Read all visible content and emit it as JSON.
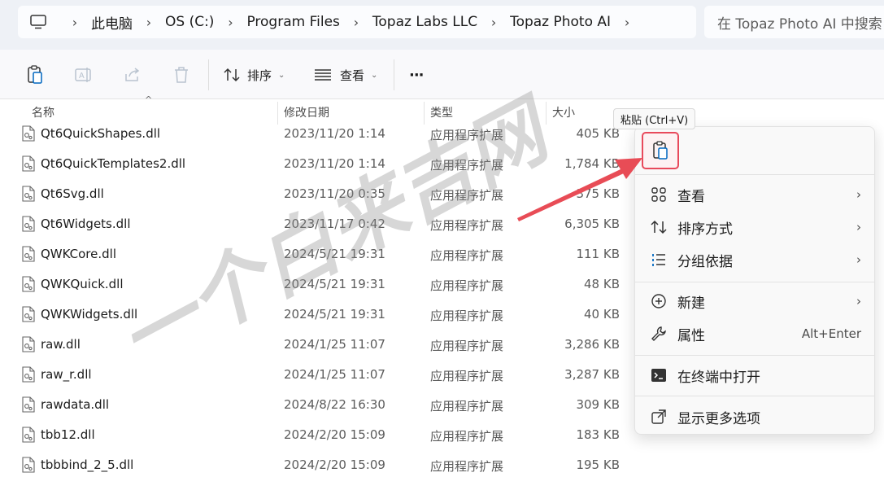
{
  "breadcrumb": [
    "此电脑",
    "OS (C:)",
    "Program Files",
    "Topaz Labs LLC",
    "Topaz Photo AI"
  ],
  "search": {
    "placeholder": "在 Topaz Photo AI 中搜索"
  },
  "toolbar": {
    "icons": [
      "paste-icon",
      "rename-icon",
      "share-icon",
      "delete-icon"
    ],
    "sort_label": "排序",
    "view_label": "查看",
    "more_label": "···"
  },
  "columns": {
    "name": "名称",
    "date": "修改日期",
    "type": "类型",
    "size": "大小"
  },
  "files": [
    {
      "name": "Qt6QuickShapes.dll",
      "date": "2023/11/20 1:14",
      "type": "应用程序扩展",
      "size": "405 KB"
    },
    {
      "name": "Qt6QuickTemplates2.dll",
      "date": "2023/11/20 1:14",
      "type": "应用程序扩展",
      "size": "1,784 KB"
    },
    {
      "name": "Qt6Svg.dll",
      "date": "2023/11/20 0:35",
      "type": "应用程序扩展",
      "size": "375 KB"
    },
    {
      "name": "Qt6Widgets.dll",
      "date": "2023/11/17 0:42",
      "type": "应用程序扩展",
      "size": "6,305 KB"
    },
    {
      "name": "QWKCore.dll",
      "date": "2024/5/21 19:31",
      "type": "应用程序扩展",
      "size": "111 KB"
    },
    {
      "name": "QWKQuick.dll",
      "date": "2024/5/21 19:31",
      "type": "应用程序扩展",
      "size": "48 KB"
    },
    {
      "name": "QWKWidgets.dll",
      "date": "2024/5/21 19:31",
      "type": "应用程序扩展",
      "size": "40 KB"
    },
    {
      "name": "raw.dll",
      "date": "2024/1/25 11:07",
      "type": "应用程序扩展",
      "size": "3,286 KB"
    },
    {
      "name": "raw_r.dll",
      "date": "2024/1/25 11:07",
      "type": "应用程序扩展",
      "size": "3,287 KB"
    },
    {
      "name": "rawdata.dll",
      "date": "2024/8/22 16:30",
      "type": "应用程序扩展",
      "size": "309 KB"
    },
    {
      "name": "tbb12.dll",
      "date": "2024/2/20 15:09",
      "type": "应用程序扩展",
      "size": "183 KB"
    },
    {
      "name": "tbbbind_2_5.dll",
      "date": "2024/2/20 15:09",
      "type": "应用程序扩展",
      "size": "195 KB"
    }
  ],
  "tooltip": "粘贴 (Ctrl+V)",
  "menu": {
    "items": [
      {
        "label": "查看",
        "icon": "grid-icon",
        "submenu": true
      },
      {
        "label": "排序方式",
        "icon": "sort-icon",
        "submenu": true
      },
      {
        "label": "分组依据",
        "icon": "group-icon",
        "submenu": true
      },
      {
        "label": "新建",
        "icon": "new-icon",
        "submenu": true
      },
      {
        "label": "属性",
        "icon": "wrench-icon",
        "shortcut": "Alt+Enter"
      },
      {
        "label": "在终端中打开",
        "icon": "terminal-icon"
      },
      {
        "label": "显示更多选项",
        "icon": "more-options-icon"
      }
    ]
  },
  "watermark": "一个白来吉网",
  "colors": {
    "accent": "#0067c0",
    "highlight": "#e8495b",
    "arrow": "#e84c56"
  }
}
